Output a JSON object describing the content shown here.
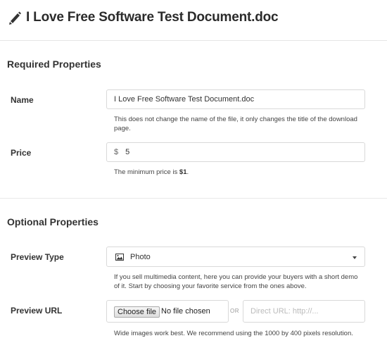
{
  "header": {
    "title": "I Love Free Software Test Document.doc",
    "icon": "pencil-icon"
  },
  "required": {
    "title": "Required Properties",
    "name": {
      "label": "Name",
      "value": "I Love Free Software Test Document.doc",
      "help": "This does not change the name of the file, it only changes the title of the download page."
    },
    "price": {
      "label": "Price",
      "currency": "$",
      "value": "5",
      "help_prefix": "The minimum price is ",
      "help_bold": "$1",
      "help_suffix": "."
    }
  },
  "optional": {
    "title": "Optional Properties",
    "preview_type": {
      "label": "Preview Type",
      "selected": "Photo",
      "icon": "image-icon",
      "help": "If you sell multimedia content, here you can provide your buyers with a short demo of it. Start by choosing your favorite service from the ones above."
    },
    "preview_url": {
      "label": "Preview URL",
      "file_button": "Choose file",
      "file_status": "No file chosen",
      "or_text": "OR",
      "url_placeholder": "Direct URL: http://...",
      "help": "Wide images work best. We recommend using the 1000 by 400 pixels resolution."
    }
  }
}
